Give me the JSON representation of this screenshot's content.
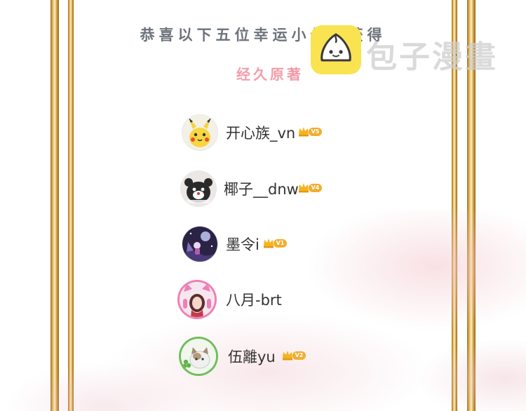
{
  "header": {
    "title": "恭喜以下五位幸运小伙伴获得",
    "subtitle": "经久原著"
  },
  "watermark": {
    "text": "包子漫畫",
    "logo_icon": "steamed-bun-icon"
  },
  "winners": [
    {
      "name": "开心族_vn",
      "vip": "V5",
      "avatar_icon": "pikachu-avatar-icon"
    },
    {
      "name": "椰子__dnw",
      "vip": "V4",
      "avatar_icon": "cartoon-bear-avatar-icon"
    },
    {
      "name": "墨令i",
      "vip": "V1",
      "avatar_icon": "night-scene-avatar-icon"
    },
    {
      "name": "八月-brt",
      "vip": "",
      "avatar_icon": "cat-ear-headphones-avatar-icon"
    },
    {
      "name": "伍離yu",
      "vip": "V2",
      "avatar_icon": "clover-frame-cat-avatar-icon"
    }
  ],
  "colors": {
    "title": "#6d737c",
    "subtitle": "#f19eaa",
    "gold_frame": "#d8a547",
    "vip_badge": "#f2ad2f",
    "watermark_logo": "#f9e351"
  }
}
